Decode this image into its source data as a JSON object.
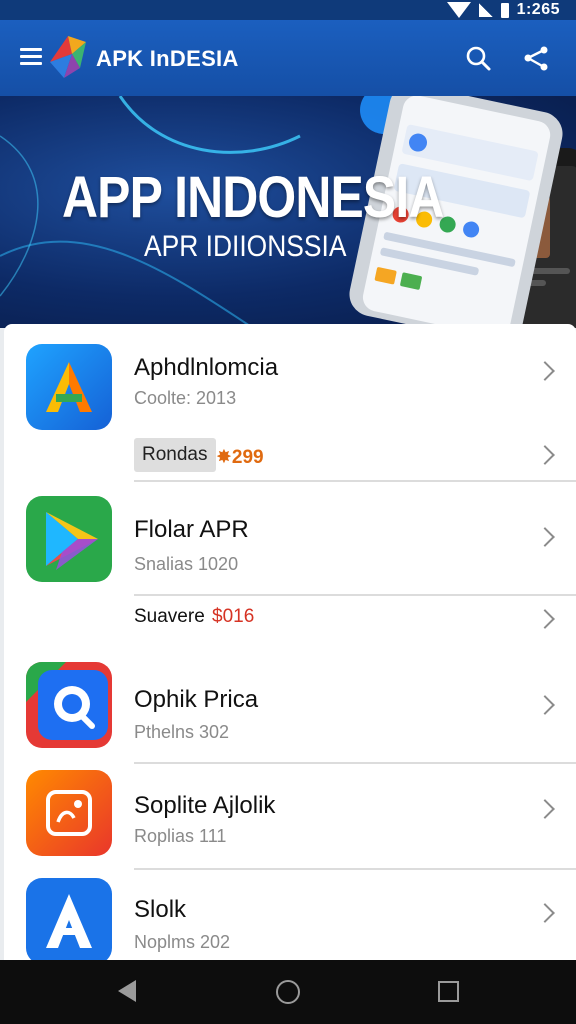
{
  "status_bar": {
    "time": "1:265"
  },
  "app_bar": {
    "title": "APK InDESIA"
  },
  "banner": {
    "title": "APP INDONESIA",
    "subtitle": "APR IDIIONSSIA"
  },
  "list": {
    "items": [
      {
        "name": "Aphdlnlomcia",
        "subtitle": "Coolte: 2013",
        "tag": "Rondas",
        "tag_price": "299"
      },
      {
        "name": "Flolar APR",
        "subtitle": "Snalias 1020",
        "extra_label": "Suavere",
        "extra_price": "$016"
      },
      {
        "name": "Ophik Prica",
        "subtitle": "Pthelns 302"
      },
      {
        "name": "Soplite Ajlolik",
        "subtitle": "Roplias 111"
      },
      {
        "name": "Slolk",
        "subtitle": "Noplms 202"
      }
    ]
  },
  "colors": {
    "app_bar": "#1b5fbf",
    "banner": "#0d2a66",
    "price_orange": "#e06a10",
    "price_red": "#d63324"
  }
}
